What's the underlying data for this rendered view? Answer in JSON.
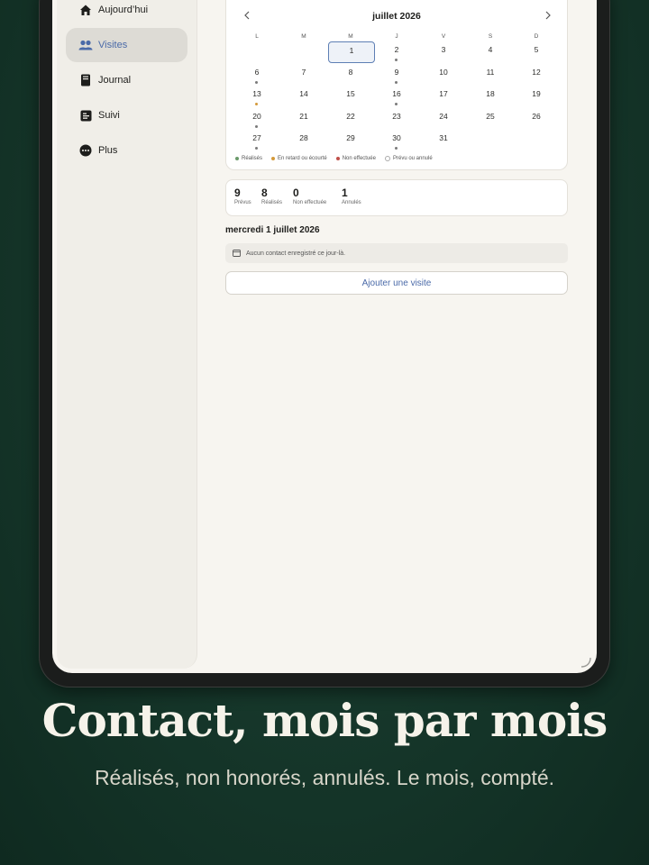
{
  "sidebar": {
    "items": [
      {
        "label": "Aujourd’hui",
        "icon": "home-icon"
      },
      {
        "label": "Visites",
        "icon": "people-icon",
        "active": true
      },
      {
        "label": "Journal",
        "icon": "book-icon"
      },
      {
        "label": "Suivi",
        "icon": "tracking-icon"
      },
      {
        "label": "Plus",
        "icon": "more-icon"
      }
    ]
  },
  "calendar": {
    "month": "juillet 2026",
    "weekdays": [
      "L",
      "M",
      "M",
      "J",
      "V",
      "S",
      "D"
    ],
    "days": [
      "1",
      "2",
      "3",
      "4",
      "5",
      "6",
      "7",
      "8",
      "9",
      "10",
      "11",
      "12",
      "13",
      "14",
      "15",
      "16",
      "17",
      "18",
      "19",
      "20",
      "21",
      "22",
      "23",
      "24",
      "25",
      "26",
      "27",
      "28",
      "29",
      "30",
      "31"
    ],
    "selected_day": "1",
    "legend": [
      "Réalisés",
      "En retard ou écourté",
      "Non effectuée",
      "Prévu ou annulé"
    ]
  },
  "stats": [
    {
      "value": "9",
      "label": "Prévus"
    },
    {
      "value": "8",
      "label": "Réalisés"
    },
    {
      "value": "0",
      "label": "Non effectuée"
    },
    {
      "value": "1",
      "label": "Annulés"
    }
  ],
  "day_view": {
    "title": "mercredi 1 juillet 2026",
    "empty_text": "Aucun contact enregistré ce jour-là.",
    "add_button": "Ajouter une visite"
  },
  "marketing": {
    "headline": "Contact, mois par mois",
    "subline": "Réalisés, non honorés, annulés. Le mois, compté."
  },
  "colors": {
    "accent": "#4a6aa8",
    "background_green": "#17392c",
    "legend_realises": "#6a9a6a",
    "legend_retard": "#d49a3a",
    "legend_non_effectuee": "#c0504a",
    "legend_prevu": "#ffffff"
  }
}
